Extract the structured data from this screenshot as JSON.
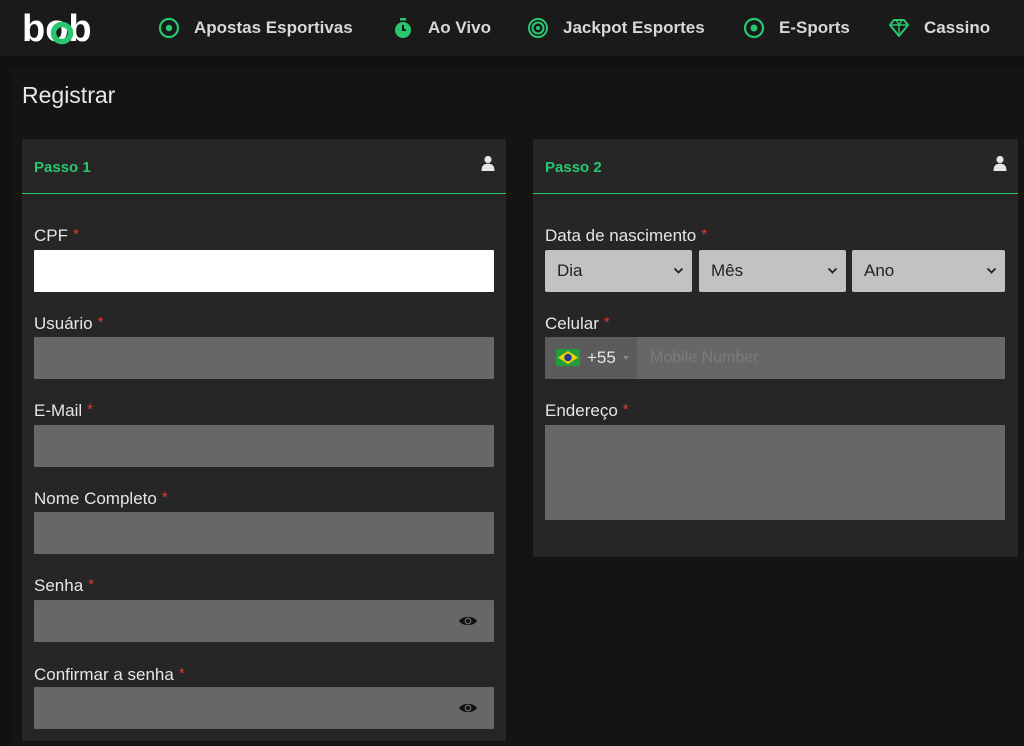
{
  "nav": {
    "logo": "bob",
    "items": [
      {
        "label": "Apostas Esportivas",
        "icon": "soccer-ball-icon"
      },
      {
        "label": "Ao Vivo",
        "icon": "stopwatch-icon"
      },
      {
        "label": "Jackpot Esportes",
        "icon": "target-icon"
      },
      {
        "label": "E-Sports",
        "icon": "gamepad-icon"
      },
      {
        "label": "Cassino",
        "icon": "diamond-icon"
      }
    ]
  },
  "page": {
    "title": "Registrar"
  },
  "step1": {
    "title": "Passo 1",
    "fields": {
      "cpf": {
        "label": "CPF",
        "required": "*",
        "value": ""
      },
      "usuario": {
        "label": "Usuário",
        "required": "*",
        "value": ""
      },
      "email": {
        "label": "E-Mail",
        "required": "*",
        "value": ""
      },
      "nome": {
        "label": "Nome Completo",
        "required": "*",
        "value": ""
      },
      "senha": {
        "label": "Senha",
        "required": "*",
        "value": ""
      },
      "confirmar": {
        "label": "Confirmar a senha",
        "required": "*",
        "value": ""
      }
    }
  },
  "step2": {
    "title": "Passo 2",
    "birth": {
      "label": "Data de nascimento",
      "required": "*",
      "day": "Dia",
      "month": "Mês",
      "year": "Ano"
    },
    "phone": {
      "label": "Celular",
      "required": "*",
      "country_code": "+55",
      "placeholder": "Mobile Number"
    },
    "address": {
      "label": "Endereço",
      "required": "*",
      "value": ""
    }
  },
  "colors": {
    "accent": "#28c76f",
    "required": "#e03c31",
    "panel": "#262626",
    "field": "#676767"
  }
}
